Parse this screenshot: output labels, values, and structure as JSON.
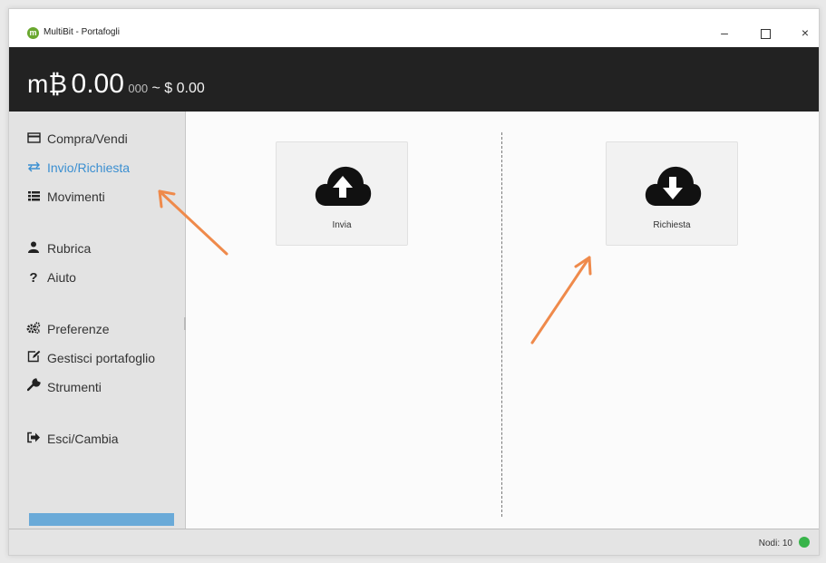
{
  "window": {
    "title": "MultiBit - Portafogli",
    "controls": {
      "minimize": "–",
      "close": "×"
    }
  },
  "header": {
    "unit": "m₿",
    "balance_main": "0.00",
    "balance_small": "000",
    "fiat": "~ $ 0.00"
  },
  "sidebar": {
    "items": [
      {
        "label": "Compra/Vendi",
        "icon": "credit-card-icon",
        "active": false
      },
      {
        "label": "Invio/Richiesta",
        "icon": "exchange-icon",
        "active": true
      },
      {
        "label": "Movimenti",
        "icon": "list-icon",
        "active": false
      },
      {
        "label": "Rubrica",
        "icon": "user-icon",
        "active": false
      },
      {
        "label": "Aiuto",
        "icon": "question-icon",
        "active": false
      },
      {
        "label": "Preferenze",
        "icon": "gears-icon",
        "active": false
      },
      {
        "label": "Gestisci portafoglio",
        "icon": "edit-icon",
        "active": false
      },
      {
        "label": "Strumenti",
        "icon": "wrench-icon",
        "active": false
      },
      {
        "label": "Esci/Cambia",
        "icon": "sign-out-icon",
        "active": false
      }
    ]
  },
  "actions": {
    "send_label": "Invia",
    "receive_label": "Richiesta"
  },
  "status": {
    "peers": "Nodi: 10",
    "connected_color": "#38b44a"
  },
  "colors": {
    "accent": "#3b8fd1",
    "header_bg": "#222222",
    "annotation_arrow": "#ef8a4b"
  }
}
